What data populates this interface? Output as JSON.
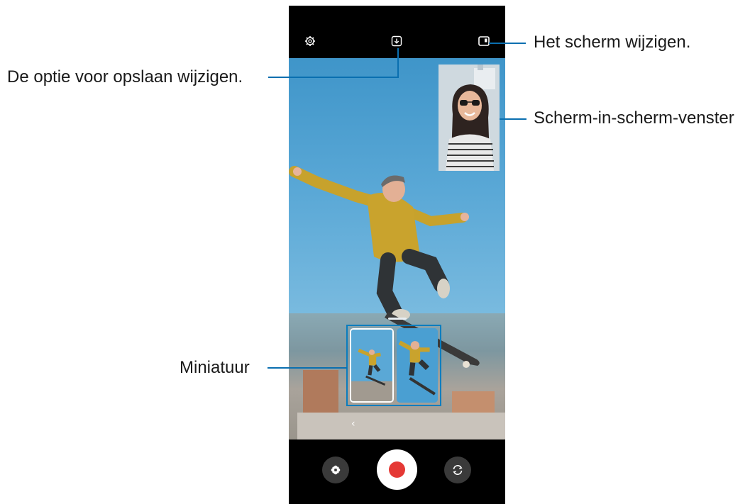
{
  "callouts": {
    "save_option": "De optie voor opslaan wijzigen.",
    "change_screen": "Het scherm wijzigen.",
    "pip_window": "Scherm-in-scherm-venster",
    "thumbnail": "Miniatuur"
  },
  "icons": {
    "settings": "gear-icon",
    "save_option": "download-icon",
    "screen_layout": "pip-layout-icon",
    "collapse": "chevron-left-icon",
    "filter": "filter-icon",
    "record": "record-button",
    "switch_camera": "switch-camera-icon"
  },
  "colors": {
    "callout_line": "#0a6fb0",
    "record_dot": "#e53935",
    "sky": "#4fa2d3",
    "jacket": "#c7a22c"
  },
  "glyphs": {
    "chevron": "‹"
  }
}
